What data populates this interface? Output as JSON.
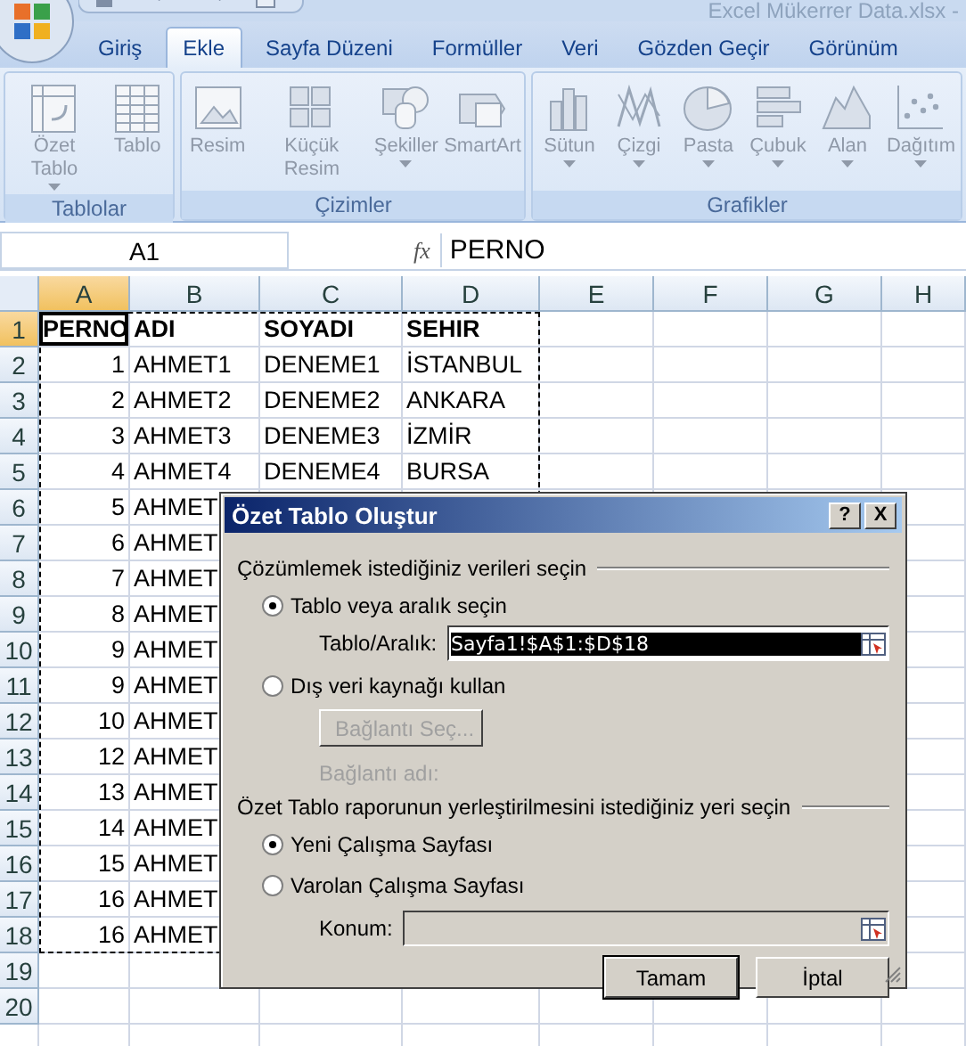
{
  "window": {
    "title": "Excel Mükerrer Data.xlsx -"
  },
  "ribbon": {
    "tabs": [
      {
        "label": "Giriş",
        "selected": false
      },
      {
        "label": "Ekle",
        "selected": true
      },
      {
        "label": "Sayfa Düzeni",
        "selected": false
      },
      {
        "label": "Formüller",
        "selected": false
      },
      {
        "label": "Veri",
        "selected": false
      },
      {
        "label": "Gözden Geçir",
        "selected": false
      },
      {
        "label": "Görünüm",
        "selected": false
      }
    ],
    "groups": [
      {
        "label": "Tablolar",
        "buttons": [
          {
            "label": "Özet Tablo",
            "dropdown": true
          },
          {
            "label": "Tablo",
            "dropdown": false
          }
        ]
      },
      {
        "label": "Çizimler",
        "buttons": [
          {
            "label": "Resim",
            "dropdown": false
          },
          {
            "label": "Küçük Resim",
            "dropdown": false
          },
          {
            "label": "Şekiller",
            "dropdown": true
          },
          {
            "label": "SmartArt",
            "dropdown": false
          }
        ]
      },
      {
        "label": "Grafikler",
        "buttons": [
          {
            "label": "Sütun",
            "dropdown": true
          },
          {
            "label": "Çizgi",
            "dropdown": true
          },
          {
            "label": "Pasta",
            "dropdown": true
          },
          {
            "label": "Çubuk",
            "dropdown": true
          },
          {
            "label": "Alan",
            "dropdown": true
          },
          {
            "label": "Dağıtım",
            "dropdown": true
          }
        ]
      }
    ]
  },
  "formula_bar": {
    "name_box": "A1",
    "function_label": "fx",
    "content": "PERNO"
  },
  "sheet": {
    "columns": [
      {
        "label": "A",
        "selected": true
      },
      {
        "label": "B",
        "selected": false
      },
      {
        "label": "C",
        "selected": false
      },
      {
        "label": "D",
        "selected": false
      },
      {
        "label": "E",
        "selected": false
      },
      {
        "label": "F",
        "selected": false
      },
      {
        "label": "G",
        "selected": false
      },
      {
        "label": "H",
        "selected": false
      }
    ],
    "rows": [
      {
        "label": "1",
        "selected": true,
        "kind": "header",
        "cells": [
          "PERNO",
          "ADI",
          "SOYADI",
          "SEHIR"
        ]
      },
      {
        "label": "2",
        "selected": false,
        "kind": "data",
        "cells": [
          "1",
          "AHMET1",
          "DENEME1",
          "İSTANBUL"
        ]
      },
      {
        "label": "3",
        "selected": false,
        "kind": "data",
        "cells": [
          "2",
          "AHMET2",
          "DENEME2",
          "ANKARA"
        ]
      },
      {
        "label": "4",
        "selected": false,
        "kind": "data",
        "cells": [
          "3",
          "AHMET3",
          "DENEME3",
          "İZMİR"
        ]
      },
      {
        "label": "5",
        "selected": false,
        "kind": "data",
        "cells": [
          "4",
          "AHMET4",
          "DENEME4",
          "BURSA"
        ]
      },
      {
        "label": "6",
        "selected": false,
        "kind": "data",
        "cells": [
          "5",
          "AHMET"
        ]
      },
      {
        "label": "7",
        "selected": false,
        "kind": "data",
        "cells": [
          "6",
          "AHMET"
        ]
      },
      {
        "label": "8",
        "selected": false,
        "kind": "data",
        "cells": [
          "7",
          "AHMET"
        ]
      },
      {
        "label": "9",
        "selected": false,
        "kind": "data",
        "cells": [
          "8",
          "AHMET"
        ]
      },
      {
        "label": "10",
        "selected": false,
        "kind": "data",
        "cells": [
          "9",
          "AHMET"
        ]
      },
      {
        "label": "11",
        "selected": false,
        "kind": "data",
        "cells": [
          "9",
          "AHMET"
        ]
      },
      {
        "label": "12",
        "selected": false,
        "kind": "data",
        "cells": [
          "10",
          "AHMET"
        ]
      },
      {
        "label": "13",
        "selected": false,
        "kind": "data",
        "cells": [
          "12",
          "AHMET"
        ]
      },
      {
        "label": "14",
        "selected": false,
        "kind": "data",
        "cells": [
          "13",
          "AHMET"
        ]
      },
      {
        "label": "15",
        "selected": false,
        "kind": "data",
        "cells": [
          "14",
          "AHMET"
        ]
      },
      {
        "label": "16",
        "selected": false,
        "kind": "data",
        "cells": [
          "15",
          "AHMET"
        ]
      },
      {
        "label": "17",
        "selected": false,
        "kind": "data",
        "cells": [
          "16",
          "AHMET"
        ]
      },
      {
        "label": "18",
        "selected": false,
        "kind": "data",
        "cells": [
          "16",
          "AHMET"
        ]
      },
      {
        "label": "19",
        "selected": false,
        "kind": "data",
        "cells": []
      },
      {
        "label": "20",
        "selected": false,
        "kind": "data",
        "cells": []
      }
    ]
  },
  "dialog": {
    "title": "Özet Tablo Oluştur",
    "title_buttons": [
      "?",
      "X"
    ],
    "source_heading": "Çözümlemek istediğiniz verileri seçin",
    "source_options": [
      {
        "label": "Tablo veya aralık seçin",
        "selected": true
      },
      {
        "label": "Dış veri kaynağı kullan",
        "selected": false
      }
    ],
    "range_label": "Tablo/Aralık:",
    "range_value": "Sayfa1!$A$1:$D$18",
    "connection_button": {
      "label": "Bağlantı Seç...",
      "disabled": true
    },
    "connection_name_label": "Bağlantı adı:",
    "destination_heading": "Özet Tablo raporunun yerleştirilmesini istediğiniz yeri seçin",
    "destination_options": [
      {
        "label": "Yeni Çalışma Sayfası",
        "selected": true
      },
      {
        "label": "Varolan Çalışma Sayfası",
        "selected": false
      }
    ],
    "location_label": "Konum:",
    "buttons": [
      {
        "label": "Tamam",
        "default": true
      },
      {
        "label": "İptal",
        "default": false
      }
    ]
  }
}
